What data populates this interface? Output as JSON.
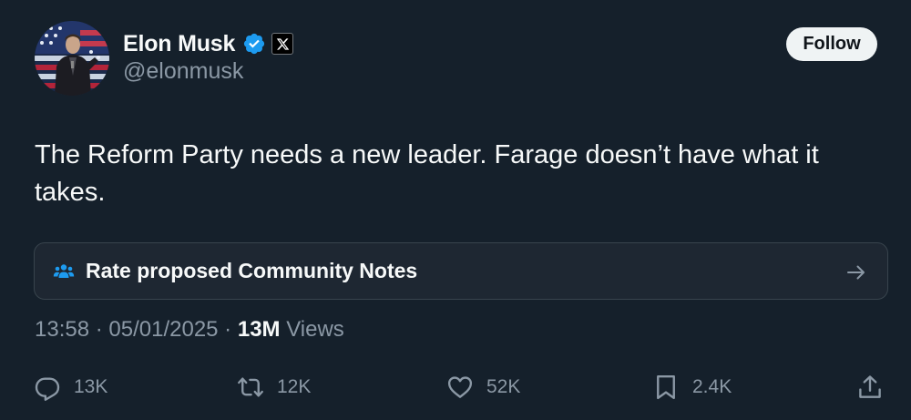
{
  "author": {
    "display_name": "Elon Musk",
    "handle": "@elonmusk",
    "verified": true,
    "affiliation_badge": "x-logo-icon"
  },
  "follow_button": {
    "label": "Follow"
  },
  "tweet": {
    "text": "The Reform Party needs a new leader. Farage doesn’t have what it takes."
  },
  "community_notes": {
    "label": "Rate proposed Community Notes",
    "icon": "people-group-icon",
    "arrow_icon": "arrow-right-icon"
  },
  "meta": {
    "time": "13:58",
    "separator": " · ",
    "date": "05/01/2025",
    "views_count": "13M",
    "views_label": " Views"
  },
  "actions": {
    "replies": "13K",
    "reposts": "12K",
    "likes": "52K",
    "bookmarks": "2.4K"
  },
  "colors": {
    "background": "#15202b",
    "verified_blue": "#1d9bf0",
    "secondary_text": "#8b98a5",
    "accent": "#1d9bf0"
  }
}
